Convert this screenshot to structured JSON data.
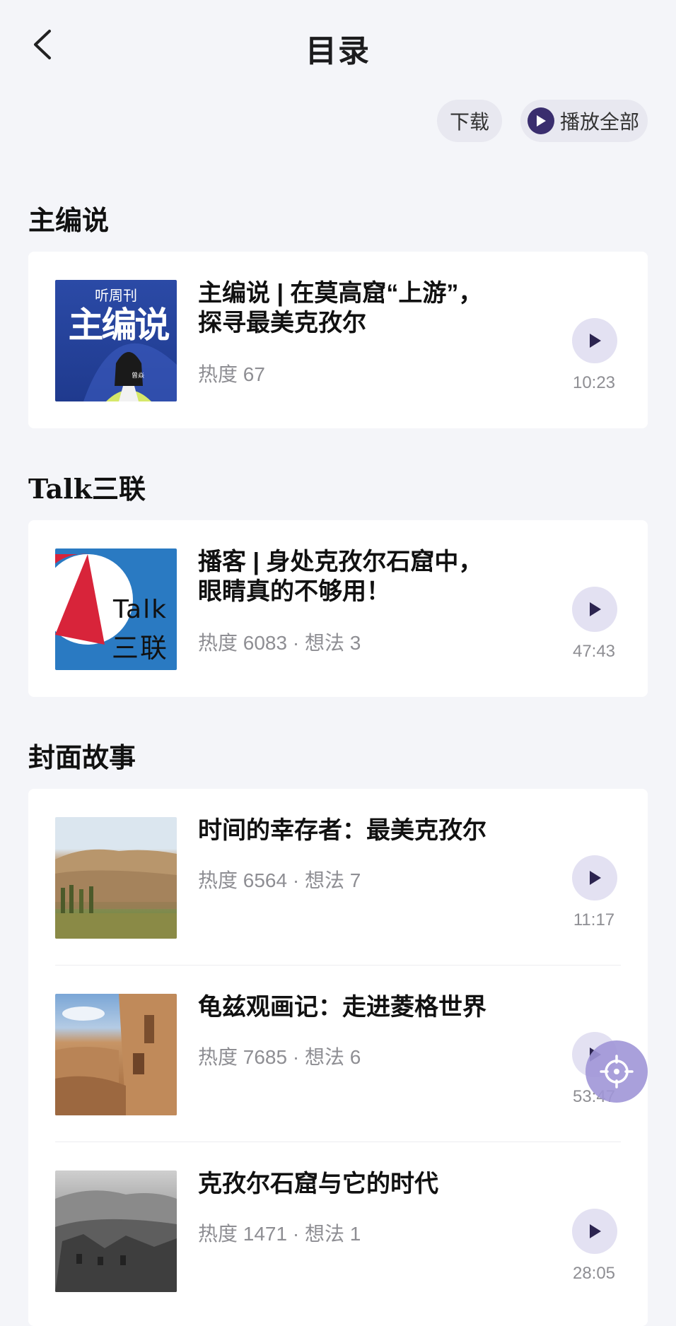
{
  "header": {
    "title": "目录",
    "back_icon": "chevron-left-icon"
  },
  "actions": {
    "download_label": "下载",
    "play_all_label": "播放全部"
  },
  "colors": {
    "accent": "#3a2e6e",
    "play_button_bg": "#e3e1f2",
    "background": "#f4f5f9"
  },
  "sections": [
    {
      "title": "主编说",
      "items": [
        {
          "title_line1": "主编说 | 在莫高窟“上游”，",
          "title_line2": "探寻最美克孜尔",
          "meta": "热度 67",
          "duration": "10:23",
          "thumb_text": {
            "top": "听周刊",
            "main": "主编说",
            "small": "曾焱"
          }
        }
      ]
    },
    {
      "title": "Talk三联",
      "items": [
        {
          "title_line1": "播客 | 身处克孜尔石窟中，",
          "title_line2": "眼睛真的不够用！",
          "meta": "热度 6083 · 想法 3",
          "duration": "47:43",
          "thumb_text": {
            "top": "Talk",
            "main": "三联"
          }
        }
      ]
    },
    {
      "title": "封面故事",
      "items": [
        {
          "title_line1": "时间的幸存者：最美克孜尔",
          "meta": "热度 6564 · 想法 7",
          "duration": "11:17"
        },
        {
          "title_line1": "龟兹观画记：走进菱格世界",
          "meta": "热度 7685 · 想法 6",
          "duration": "53:47"
        },
        {
          "title_line1": "克孜尔石窟与它的时代",
          "meta": "热度 1471 · 想法 1",
          "duration": "28:05"
        }
      ]
    }
  ]
}
